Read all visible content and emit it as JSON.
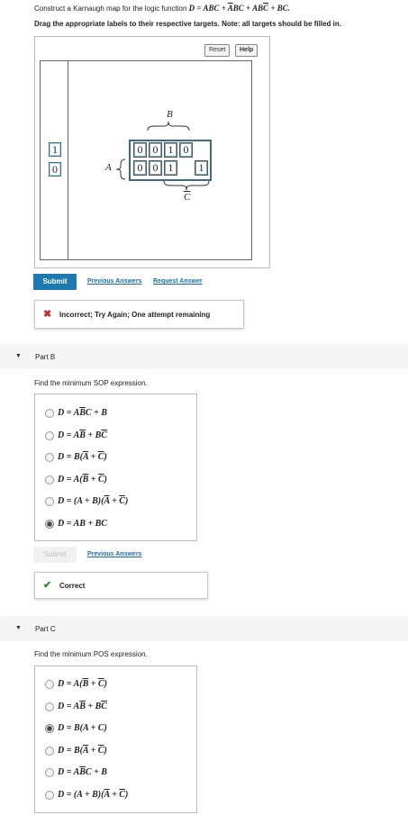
{
  "part_a": {
    "intro_prefix": "Construct a Karnaugh map for the logic function ",
    "function_text": "D = ABC + ABC + ABC + BC.",
    "instruction": "Drag the appropriate labels to their respective targets. Note: all targets should be filled in.",
    "reset_label": "Reset",
    "help_label": "Help",
    "tray_labels": [
      "1",
      "0"
    ],
    "kmap": {
      "row_var": "A",
      "top_var": "B",
      "bottom_var": "C",
      "row0": [
        "0",
        "0",
        "1",
        "0"
      ],
      "row1": [
        "0",
        "0",
        "1",
        "1"
      ]
    },
    "submit_label": "Submit",
    "previous_answers_label": "Previous Answers",
    "request_answer_label": "Request Answer",
    "feedback_text": "Incorrect; Try Again; One attempt remaining"
  },
  "part_b": {
    "title": "Part B",
    "prompt": "Find the minimum SOP expression.",
    "options": [
      "D = ABC + B",
      "D = AB + BC",
      "D = B(A + C)",
      "D = A(B + C)",
      "D = (A + B)(A + C)",
      "D = AB + BC"
    ],
    "selected_index": 5,
    "submit_label": "Submit",
    "previous_answers_label": "Previous Answers",
    "feedback_text": "Correct"
  },
  "part_c": {
    "title": "Part C",
    "prompt": "Find the minimum POS expression.",
    "options": [
      "D = A(B + C)",
      "D = AB + BC",
      "D = B(A + C)",
      "D = B(A + C)",
      "D = ABC + B",
      "D = (A + B)(A + C)"
    ],
    "selected_index": 2
  },
  "colors": {
    "submit_bg": "#1d7ab0",
    "link": "#1a6fa8",
    "error": "#c82c2c",
    "success": "#2b8a2b",
    "part_bar": "#f5f5f5"
  }
}
